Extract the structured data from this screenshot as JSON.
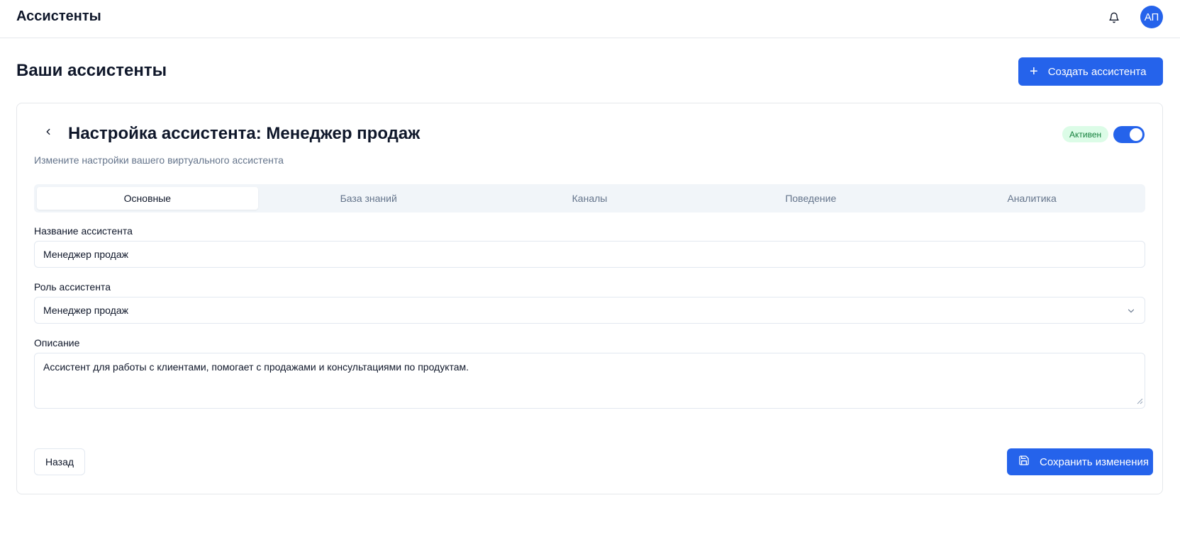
{
  "header": {
    "app_title": "Ассистенты",
    "bell_icon": "bell-icon",
    "avatar_initials": "АП"
  },
  "page": {
    "title": "Ваши ассистенты",
    "create_button_label": "Создать ассистента"
  },
  "card": {
    "title": "Настройка ассистента: Менеджер продаж",
    "subtitle": "Измените настройки вашего виртуального ассистента",
    "status_label": "Активен",
    "active": true
  },
  "tabs": [
    {
      "label": "Основные",
      "active": true
    },
    {
      "label": "База знаний",
      "active": false
    },
    {
      "label": "Каналы",
      "active": false
    },
    {
      "label": "Поведение",
      "active": false
    },
    {
      "label": "Аналитика",
      "active": false
    }
  ],
  "form": {
    "name_label": "Название ассистента",
    "name_value": "Менеджер продаж",
    "role_label": "Роль ассистента",
    "role_value": "Менеджер продаж",
    "description_label": "Описание",
    "description_value": "Ассистент для работы с клиентами, помогает с продажами и консультациями по продуктам."
  },
  "actions": {
    "back_label": "Назад",
    "save_label": "Сохранить изменения"
  },
  "colors": {
    "accent": "#2563eb",
    "badge_bg": "#dcfce7",
    "badge_text": "#15803d"
  }
}
